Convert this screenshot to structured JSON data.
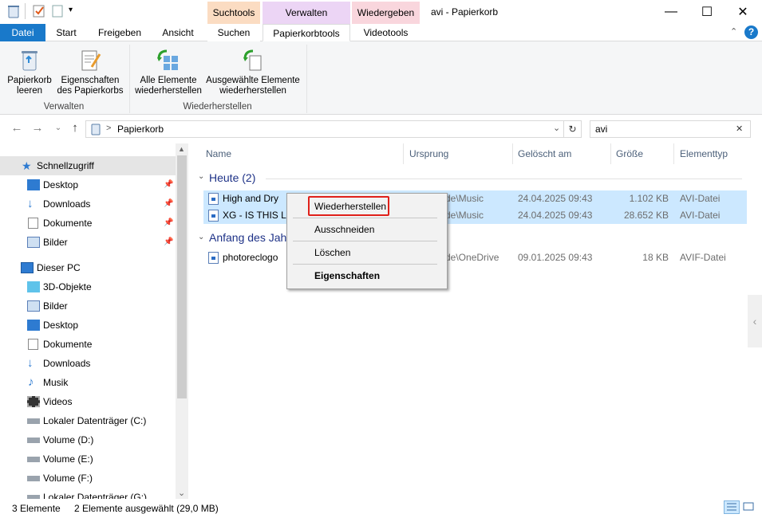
{
  "window": {
    "title": "avi - Papierkorb",
    "minimize": "—",
    "maximize": "☐",
    "close": "✕"
  },
  "context_groups": {
    "search_tools": "Suchtools",
    "manage": "Verwalten",
    "play": "Wiedergeben"
  },
  "ribbon_tabs": {
    "file": "Datei",
    "start": "Start",
    "share": "Freigeben",
    "view": "Ansicht",
    "search": "Suchen",
    "recycle_bin_tools": "Papierkorbtools",
    "video_tools": "Videotools"
  },
  "ribbon": {
    "empty_bin": "Papierkorb leeren",
    "properties_bin": "Eigenschaften des Papierkorbs",
    "group_manage": "Verwalten",
    "restore_all": "Alle Elemente wiederherstellen",
    "restore_selected": "Ausgewählte Elemente wiederherstellen",
    "group_restore": "Wiederherstellen"
  },
  "addressbar": {
    "path": "Papierkorb",
    "separator": ">",
    "search_value": "avi"
  },
  "nav": {
    "quick_access": "Schnellzugriff",
    "qa_items": [
      "Desktop",
      "Downloads",
      "Dokumente",
      "Bilder"
    ],
    "this_pc": "Dieser PC",
    "pc_items": [
      "3D-Objekte",
      "Bilder",
      "Desktop",
      "Dokumente",
      "Downloads",
      "Musik",
      "Videos",
      "Lokaler Datenträger (C:)",
      "Volume (D:)",
      "Volume (E:)",
      "Volume (F:)",
      "Lokaler Datenträger (G:)"
    ]
  },
  "columns": {
    "name": "Name",
    "origin": "Ursprung",
    "deleted": "Gelöscht am",
    "size": "Größe",
    "type": "Elementtyp"
  },
  "groups": {
    "today": "Heute (2)",
    "year_start": "Anfang des Jahres (1)"
  },
  "files": [
    {
      "name": "High and Dry",
      "origin": "de\\Music",
      "deleted": "24.04.2025 09:43",
      "size": "1.102 KB",
      "type": "AVI-Datei"
    },
    {
      "name": "XG - IS THIS LOVE",
      "origin": "de\\Music",
      "deleted": "24.04.2025 09:43",
      "size": "28.652 KB",
      "type": "AVI-Datei"
    },
    {
      "name": "photoreclogo",
      "origin": "de\\OneDrive",
      "deleted": "09.01.2025 09:43",
      "size": "18 KB",
      "type": "AVIF-Datei"
    }
  ],
  "context_menu": {
    "restore": "Wiederherstellen",
    "cut": "Ausschneiden",
    "delete": "Löschen",
    "properties": "Eigenschaften"
  },
  "status": {
    "count": "3 Elemente",
    "selected": "2 Elemente ausgewählt (29,0 MB)"
  },
  "colors": {
    "accent": "#1979ca",
    "selection": "#cce8ff",
    "highlight_box": "#e0201a"
  }
}
